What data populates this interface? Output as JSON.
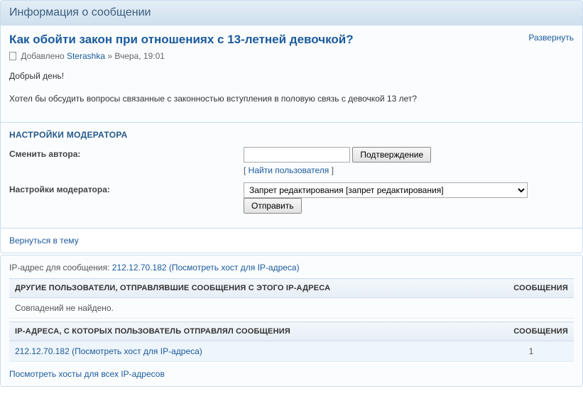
{
  "header": {
    "title": "Информация о сообщении"
  },
  "post": {
    "title": "Как обойти закон при отношениях с 13-летней девочкой?",
    "expand": "Развернуть",
    "added_prefix": "Добавлено ",
    "author": "Sterashka",
    "meta_suffix": " » Вчера, 19:01",
    "body_p1": "Добрый день!",
    "body_p2": "Хотел бы обсудить вопросы связанные с законностью вступления в половую связь с девочкой 13 лет?"
  },
  "mod": {
    "heading": "НАСТРОЙКИ МОДЕРАТОРА",
    "change_author_label": "Сменить автора:",
    "confirm_btn": "Подтверждение",
    "find_user": "Найти пользователя",
    "mod_settings_label": "Настройки модератора:",
    "select_value": "Запрет редактирования [запрет редактирования]",
    "send_btn": "Отправить"
  },
  "back_link": "Вернуться в тему",
  "ip": {
    "label": "IP-адрес для сообщения: ",
    "address": "212.12.70.182",
    "host_lookup": " (Посмотреть хост для IP-адреса)",
    "other_users_header": "ДРУГИЕ ПОЛЬЗОВАТЕЛИ, ОТПРАВЛЯВШИЕ СООБЩЕНИЯ С ЭТОГО IP-АДРЕСА",
    "messages_header": "СООБЩЕНИЯ",
    "no_matches": "Совпадений не найдено.",
    "user_ips_header": "IP-АДРЕСА, С КОТОРЫХ ПОЛЬЗОВАТЕЛЬ ОТПРАВЛЯЛ СООБЩЕНИЯ",
    "row_ip": "212.12.70.182 (Посмотреть хост для IP-адреса)",
    "row_count": "1",
    "all_hosts_link": "Посмотреть хосты для всех IP-адресов"
  }
}
